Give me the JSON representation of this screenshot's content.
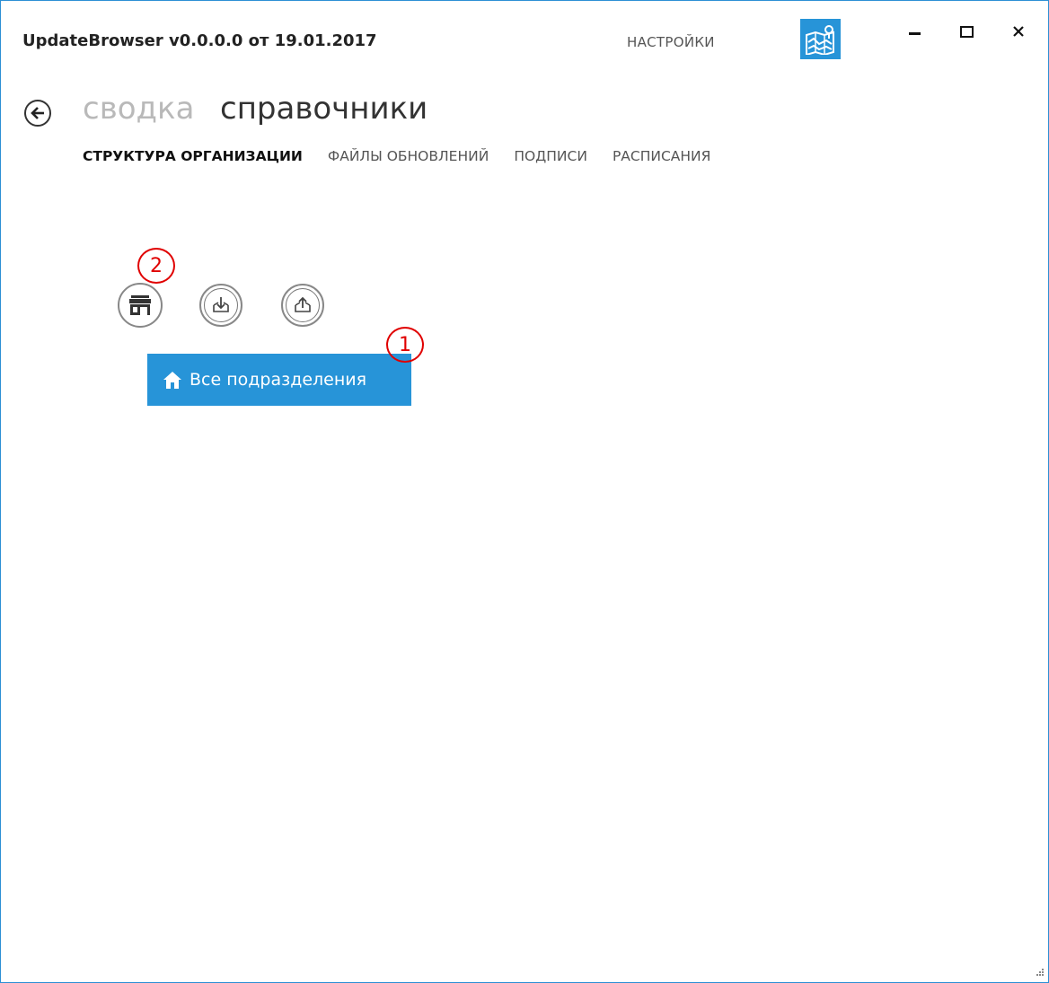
{
  "window": {
    "title": "UpdateBrowser v0.0.0.0 от 19.01.2017",
    "settings_label": "НАСТРОЙКИ",
    "minimize_label": "",
    "maximize_label": "",
    "close_label": "×",
    "accent_color": "#2794d8",
    "border_color": "#2d8fd5"
  },
  "breadcrumb": {
    "back_icon": "back-arrow-icon",
    "previous": "сводка",
    "current": "справочники"
  },
  "tabs": [
    {
      "label": "СТРУКТУРА ОРГАНИЗАЦИИ",
      "active": true
    },
    {
      "label": "ФАЙЛЫ ОБНОВЛЕНИЙ",
      "active": false
    },
    {
      "label": "ПОДПИСИ",
      "active": false
    },
    {
      "label": "РАСПИСАНИЯ",
      "active": false
    }
  ],
  "toolbar": {
    "add_icon": "store-icon",
    "import_icon": "import-icon",
    "export_icon": "export-icon"
  },
  "tree": {
    "root_icon": "home-icon",
    "root_label": "Все подразделения",
    "selected_color": "#2794d8"
  },
  "annotations": {
    "marker_1": "1",
    "marker_2": "2",
    "marker_color": "#e00000"
  }
}
